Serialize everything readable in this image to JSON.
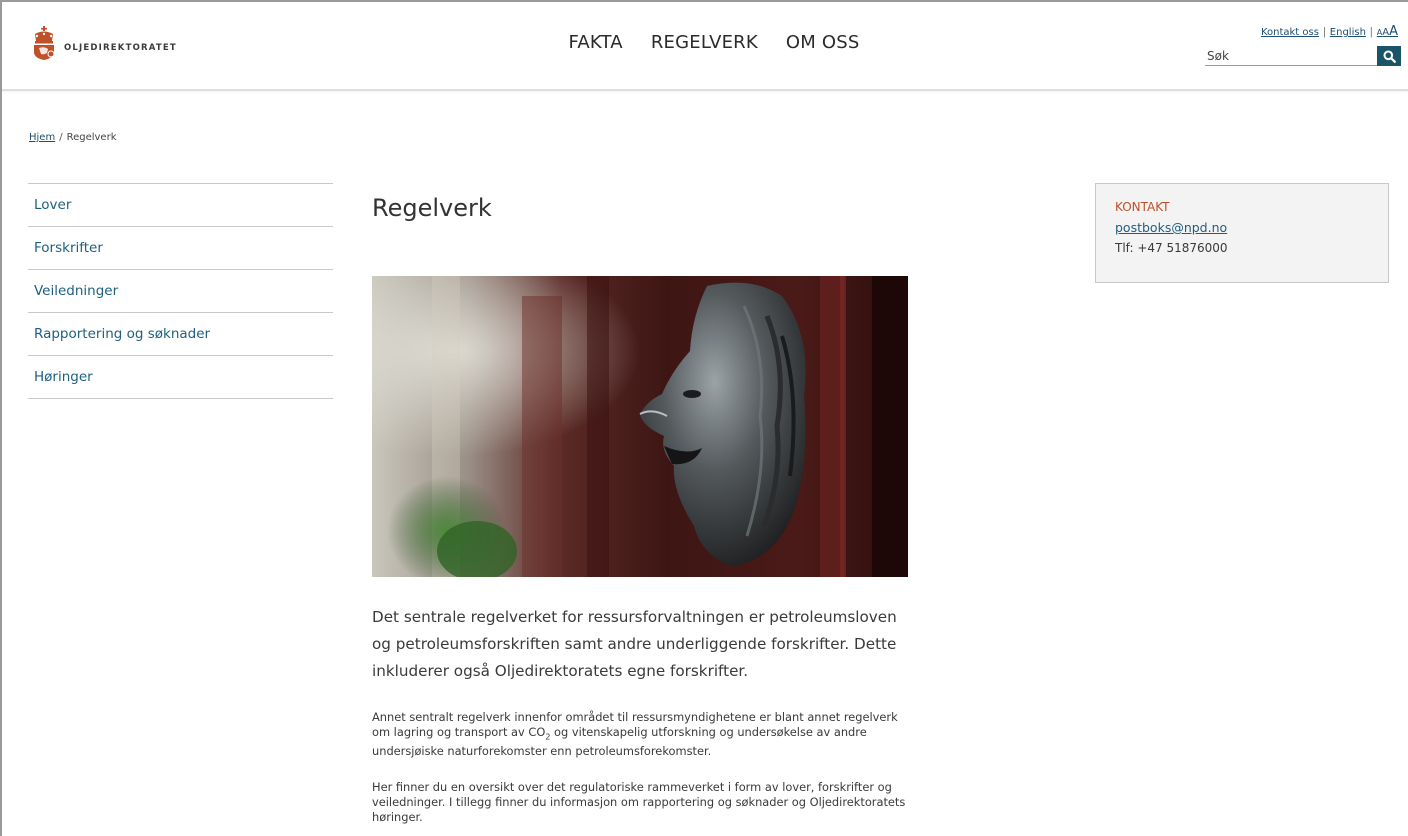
{
  "header": {
    "logo_text": "OLJEDIREKTORATET",
    "nav": [
      "FAKTA",
      "REGELVERK",
      "OM OSS"
    ],
    "util": {
      "contact_label": "Kontakt oss",
      "english_label": "English",
      "font_size_label": "AAA"
    },
    "search": {
      "placeholder": "Søk",
      "icon": "search-icon"
    }
  },
  "breadcrumb": {
    "home": "Hjem",
    "separator": "/",
    "current": "Regelverk"
  },
  "sidebar": {
    "items": [
      {
        "label": "Lover"
      },
      {
        "label": "Forskrifter"
      },
      {
        "label": "Veiledninger"
      },
      {
        "label": "Rapportering og søknader"
      },
      {
        "label": "Høringer"
      }
    ]
  },
  "main": {
    "title": "Regelverk",
    "hero_image": "lion-head-door-knocker",
    "lead": "Det sentrale regelverket for ressursforvaltningen er petroleumsloven og petroleumsforskriften samt andre underliggende forskrifter. Dette inkluderer også Oljedirektoratets egne forskrifter.",
    "p1_a": "Annet sentralt regelverk innenfor området til ressursmyndighetene er blant annet regelverk om lagring og transport av CO",
    "p1_sub": "2",
    "p1_b": " og vitenskapelig utforskning og undersøkelse av andre undersjøiske naturforekomster enn petroleumsforekomster.",
    "p2": "Her finner du en oversikt over det regulatoriske rammeverket i form av lover, forskrifter og veiledninger. I tillegg finner du informasjon om rapportering og søknader og Oljedirektoratets høringer."
  },
  "contact": {
    "heading": "KONTAKT",
    "email": "postboks@npd.no",
    "phone": "Tlf: +47 51876000"
  },
  "colors": {
    "brand_orange": "#c0502a",
    "link_blue": "#1f5f7e",
    "search_button": "#1b5368",
    "contact_bg": "#f3f3f3"
  }
}
